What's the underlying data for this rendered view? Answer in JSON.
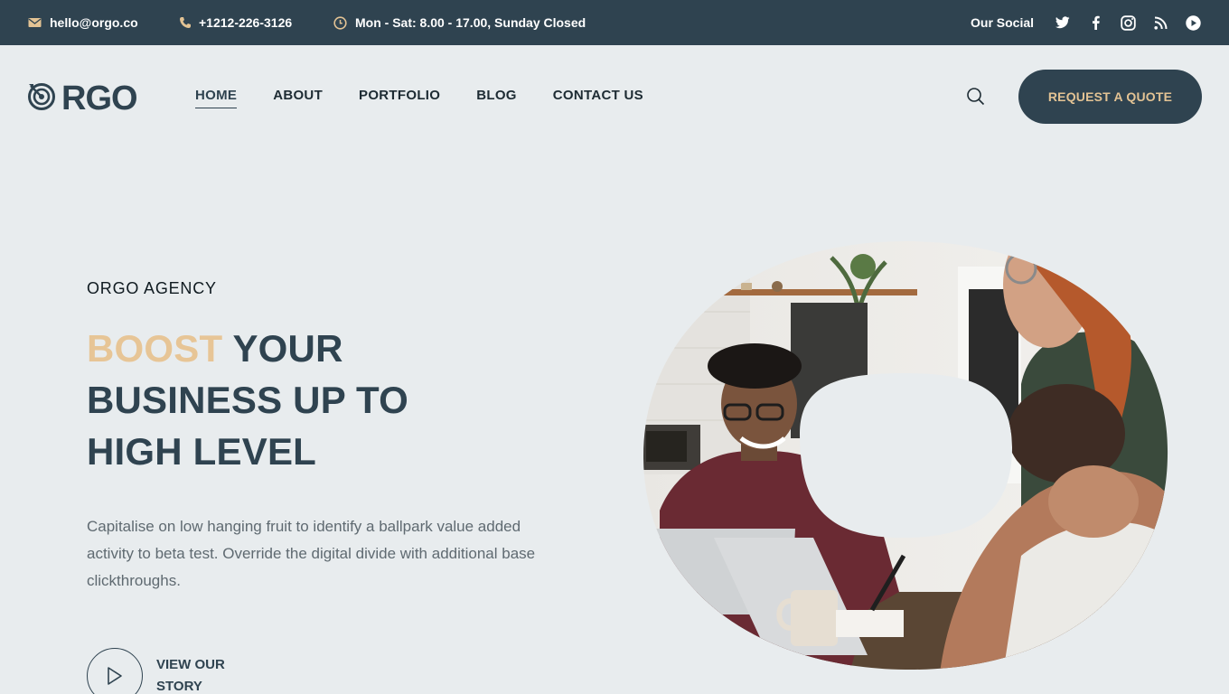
{
  "topbar": {
    "email": "hello@orgo.co",
    "phone": "+1212-226-3126",
    "hours": "Mon - Sat: 8.00 - 17.00, Sunday Closed",
    "social_label": "Our Social",
    "social_icons": [
      "twitter-icon",
      "facebook-icon",
      "instagram-icon",
      "rss-icon",
      "youtube-icon"
    ]
  },
  "header": {
    "logo_text": "RGO",
    "nav": [
      {
        "label": "HOME",
        "active": true
      },
      {
        "label": "ABOUT",
        "active": false
      },
      {
        "label": "PORTFOLIO",
        "active": false
      },
      {
        "label": "BLOG",
        "active": false
      },
      {
        "label": "CONTACT US",
        "active": false
      }
    ],
    "quote_button": "REQUEST A QUOTE"
  },
  "hero": {
    "eyebrow": "ORGO AGENCY",
    "headline_accent": "BOOST",
    "headline_rest_1": " YOUR",
    "headline_rest_2": "BUSINESS UP TO",
    "headline_rest_3": "HIGH LEVEL",
    "description": "Capitalise on low hanging fruit to identify a ballpark value added activity to beta test. Override the digital divide with additional base clickthroughs.",
    "story_label": "VIEW OUR STORY"
  },
  "colors": {
    "brand_dark": "#2f4350",
    "accent": "#e7c596",
    "background": "#e8ecee"
  }
}
